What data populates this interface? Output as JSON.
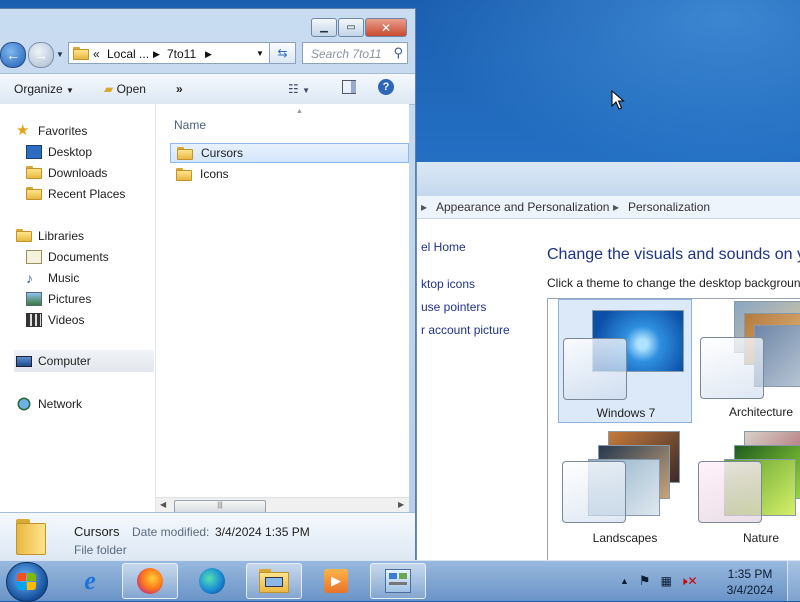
{
  "explorer": {
    "address": {
      "overflow": "«",
      "segments": [
        "Local ...",
        "7to11"
      ]
    },
    "search_placeholder": "Search 7to11",
    "toolbar": {
      "organize": "Organize",
      "open": "Open",
      "more": "»"
    },
    "nav": {
      "favorites": "Favorites",
      "desktop": "Desktop",
      "downloads": "Downloads",
      "recent_places": "Recent Places",
      "libraries": "Libraries",
      "documents": "Documents",
      "music": "Music",
      "pictures": "Pictures",
      "videos": "Videos",
      "computer": "Computer",
      "network": "Network"
    },
    "column_name": "Name",
    "files": [
      {
        "name": "Cursors",
        "selected": true
      },
      {
        "name": "Icons",
        "selected": false
      }
    ],
    "details": {
      "name": "Cursors",
      "date_label": "Date modified:",
      "date_value": "3/4/2024 1:35 PM",
      "type": "File folder"
    }
  },
  "control_panel": {
    "breadcrumb": [
      "Appearance and Personalization",
      "Personalization"
    ],
    "sidebar_links": [
      "el Home",
      "ktop icons",
      "use pointers",
      "r account picture"
    ],
    "heading": "Change the visuals and sounds on yo",
    "subheading": "Click a theme to change the desktop backgroun",
    "themes": [
      {
        "name": "Windows 7",
        "selected": true
      },
      {
        "name": "Architecture",
        "selected": false
      },
      {
        "name": "Landscapes",
        "selected": false
      },
      {
        "name": "Nature",
        "selected": false
      }
    ]
  },
  "taskbar": {
    "time": "1:35 PM",
    "date": "3/4/2024"
  },
  "colors": {
    "link": "#1e3287",
    "selection": "#d4e6fb",
    "close_button": "#c74a2f"
  }
}
